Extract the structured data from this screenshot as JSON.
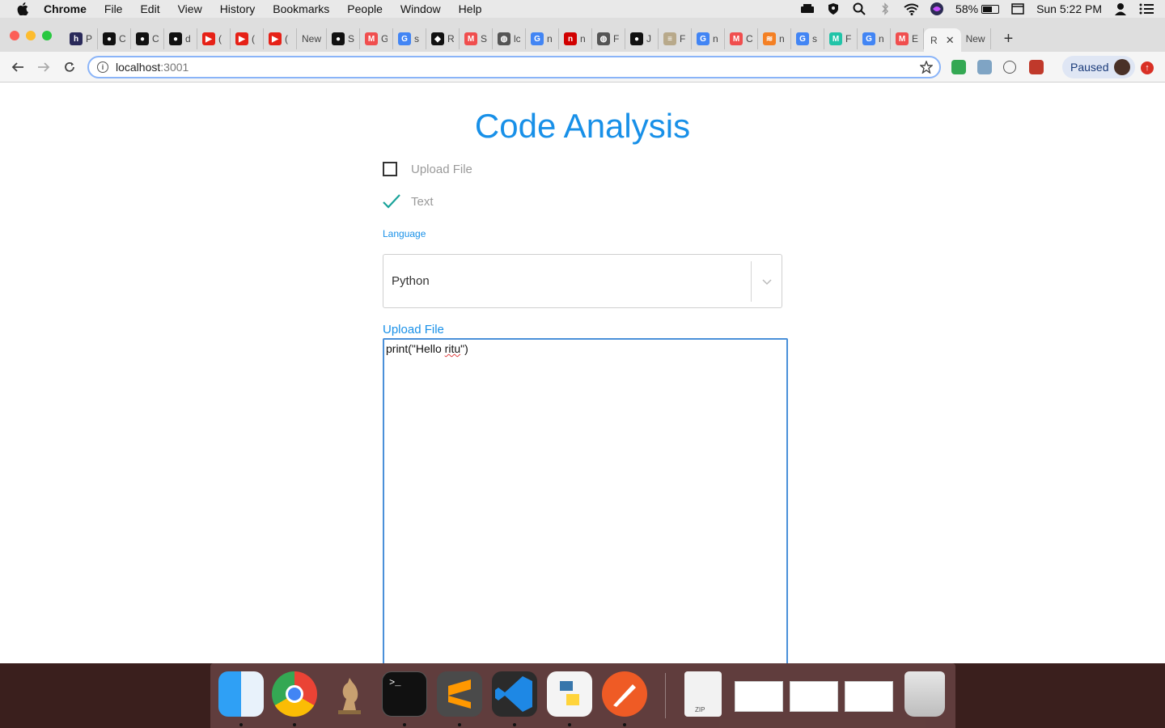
{
  "menubar": {
    "app": "Chrome",
    "items": [
      "File",
      "Edit",
      "View",
      "History",
      "Bookmarks",
      "People",
      "Window",
      "Help"
    ],
    "battery": "58%",
    "clock": "Sun 5:22 PM"
  },
  "browser": {
    "tabs": [
      {
        "letter": "P",
        "icon": "hashnode-icon",
        "color": "#2a2a5a",
        "glyph": "h"
      },
      {
        "letter": "C",
        "icon": "github-icon",
        "color": "#111",
        "glyph": "●"
      },
      {
        "letter": "C",
        "icon": "github-icon",
        "color": "#111",
        "glyph": "●"
      },
      {
        "letter": "d",
        "icon": "github-icon",
        "color": "#111",
        "glyph": "●"
      },
      {
        "letter": "(",
        "icon": "youtube-icon",
        "color": "#e62117",
        "glyph": "▶"
      },
      {
        "letter": "(",
        "icon": "youtube-icon",
        "color": "#e62117",
        "glyph": "▶"
      },
      {
        "letter": "(",
        "icon": "youtube-icon",
        "color": "#e62117",
        "glyph": "▶"
      },
      {
        "letter": "New",
        "icon": "",
        "color": "",
        "glyph": ""
      },
      {
        "letter": "S",
        "icon": "github-icon",
        "color": "#111",
        "glyph": "●"
      },
      {
        "letter": "G",
        "icon": "medium-icon",
        "color": "#f04e4e",
        "glyph": "M"
      },
      {
        "letter": "s",
        "icon": "google-icon",
        "color": "#4285f4",
        "glyph": "G"
      },
      {
        "letter": "R",
        "icon": "codepen-icon",
        "color": "#111",
        "glyph": "◆"
      },
      {
        "letter": "S",
        "icon": "medium-icon",
        "color": "#f04e4e",
        "glyph": "M"
      },
      {
        "letter": "lc",
        "icon": "globe-icon",
        "color": "#555",
        "glyph": "◍"
      },
      {
        "letter": "n",
        "icon": "google-icon",
        "color": "#4285f4",
        "glyph": "G"
      },
      {
        "letter": "n",
        "icon": "n-icon",
        "color": "#d10000",
        "glyph": "n"
      },
      {
        "letter": "F",
        "icon": "globe-icon",
        "color": "#555",
        "glyph": "◍"
      },
      {
        "letter": "J",
        "icon": "github-icon",
        "color": "#111",
        "glyph": "●"
      },
      {
        "letter": "F",
        "icon": "doc-icon",
        "color": "#b8a98a",
        "glyph": "≡"
      },
      {
        "letter": "n",
        "icon": "google-icon",
        "color": "#4285f4",
        "glyph": "G"
      },
      {
        "letter": "C",
        "icon": "medium-icon",
        "color": "#f04e4e",
        "glyph": "M"
      },
      {
        "letter": "n",
        "icon": "stackoverflow-icon",
        "color": "#f48024",
        "glyph": "≋"
      },
      {
        "letter": "s",
        "icon": "google-icon",
        "color": "#4285f4",
        "glyph": "G"
      },
      {
        "letter": "F",
        "icon": "m-icon",
        "color": "#21c4a8",
        "glyph": "M"
      },
      {
        "letter": "n",
        "icon": "google-icon",
        "color": "#4285f4",
        "glyph": "G"
      },
      {
        "letter": "E",
        "icon": "medium-icon",
        "color": "#f04e4e",
        "glyph": "M"
      }
    ],
    "active_tab": "R",
    "new_tab": "New",
    "url_host": "localhost",
    "url_port": ":3001",
    "profile_status": "Paused"
  },
  "page": {
    "title": "Code Analysis",
    "option_upload": "Upload File",
    "option_text": "Text",
    "upload_checked": false,
    "text_checked": true,
    "language_label": "Language",
    "language_value": "Python",
    "upload_label": "Upload File",
    "code_prefix": "print(\"Hello ",
    "code_misspelled": "ritu",
    "code_suffix": "\")"
  },
  "dock": {
    "apps": [
      "Finder",
      "Google Chrome",
      "Chess",
      "Terminal",
      "Sublime Text",
      "Visual Studio Code",
      "Python Launcher",
      "Postman"
    ],
    "zip_label": "ZIP"
  },
  "colors": {
    "accent": "#1890e8",
    "check": "#1aa39a"
  }
}
